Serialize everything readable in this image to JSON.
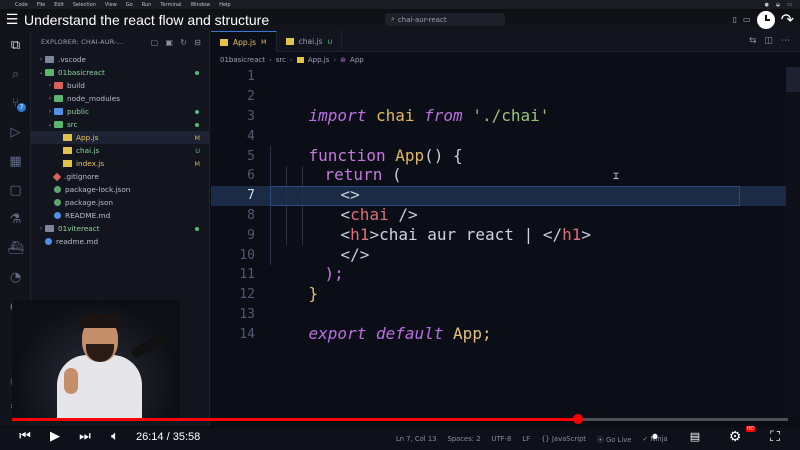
{
  "menubar": {
    "items": [
      "Code",
      "File",
      "Edit",
      "Selection",
      "View",
      "Go",
      "Run",
      "Terminal",
      "Window",
      "Help"
    ]
  },
  "video": {
    "title": "Understand the react flow and structure",
    "current_time": "26:14",
    "duration": "35:58",
    "progress": 0.729
  },
  "window": {
    "search_placeholder": "chai-aur-react"
  },
  "explorer": {
    "header": "EXPLORER: CHAI-AUR-...",
    "tree": [
      {
        "name": ".vscode",
        "type": "folder",
        "depth": 1,
        "chevron": "›",
        "color": "gray"
      },
      {
        "name": "01basicreact",
        "type": "folder",
        "depth": 1,
        "chevron": "⌄",
        "color": "green",
        "status": "dot"
      },
      {
        "name": "build",
        "type": "folder",
        "depth": 2,
        "chevron": "›",
        "color": "red"
      },
      {
        "name": "node_modules",
        "type": "folder",
        "depth": 2,
        "chevron": "›",
        "color": "green"
      },
      {
        "name": "public",
        "type": "folder",
        "depth": 2,
        "chevron": "›",
        "color": "blue",
        "status": "dot"
      },
      {
        "name": "src",
        "type": "folder",
        "depth": 2,
        "chevron": "⌄",
        "color": "green",
        "status": "dot"
      },
      {
        "name": "App.js",
        "type": "js",
        "depth": 3,
        "status": "M",
        "selected": true
      },
      {
        "name": "chai.js",
        "type": "js",
        "depth": 3,
        "status": "U"
      },
      {
        "name": "index.js",
        "type": "js",
        "depth": 3,
        "status": "M"
      },
      {
        "name": ".gitignore",
        "type": "git",
        "depth": 2
      },
      {
        "name": "package-lock.json",
        "type": "gear",
        "depth": 2
      },
      {
        "name": "package.json",
        "type": "gear",
        "depth": 2
      },
      {
        "name": "README.md",
        "type": "info",
        "depth": 2
      },
      {
        "name": "01vitereact",
        "type": "folder",
        "depth": 1,
        "chevron": "›",
        "color": "gray",
        "status": "dot"
      },
      {
        "name": "readme.md",
        "type": "info",
        "depth": 1
      }
    ]
  },
  "tabs": [
    {
      "label": "App.js",
      "status": "M",
      "active": true
    },
    {
      "label": "chai.js",
      "status": "U",
      "active": false
    }
  ],
  "breadcrumb": [
    "01basicreact",
    "src",
    "App.js",
    "App"
  ],
  "editor": {
    "current_line": 7,
    "lines": [
      {
        "n": "1"
      },
      {
        "n": "2"
      },
      {
        "n": "3"
      },
      {
        "n": "4"
      },
      {
        "n": "5"
      },
      {
        "n": "6"
      },
      {
        "n": "7"
      },
      {
        "n": "8"
      },
      {
        "n": "9"
      },
      {
        "n": "10"
      },
      {
        "n": "11"
      },
      {
        "n": "12"
      },
      {
        "n": "13"
      },
      {
        "n": "14"
      }
    ]
  },
  "code": {
    "l2_import": "import",
    "l2_chai": "chai",
    "l2_from": "from",
    "l2_path": "'./chai'",
    "l4_function": "function",
    "l4_name": "App",
    "l4_rest": "() {",
    "l5_return": "return",
    "l5_paren": "(",
    "l6_frag": "<>",
    "l7_open": "<",
    "l7_tag": "chai",
    "l7_close": " />",
    "l8_open": "<",
    "l8_tag": "h1",
    "l8_gt": ">",
    "l8_text": "chai aur react | ",
    "l8_close_open": "</",
    "l8_close_tag": "h1",
    "l8_close_gt": ">",
    "l9_frag": "</>",
    "l10": ");",
    "l11": "}",
    "l13_export": "export",
    "l13_default": "default",
    "l13_app": "App;"
  },
  "statusbar": {
    "position": "Ln 7, Col 13",
    "spaces": "Spaces: 2",
    "encoding": "UTF-8",
    "eol": "LF",
    "language": "JavaScript",
    "golive": "Go Live",
    "ninja": "Ninja"
  },
  "controls": {
    "hd_badge": "HD"
  },
  "colors": {
    "accent": "#3a78d4",
    "progress": "#ff0000",
    "modified": "#d7b25c",
    "untracked": "#4fbf73"
  }
}
